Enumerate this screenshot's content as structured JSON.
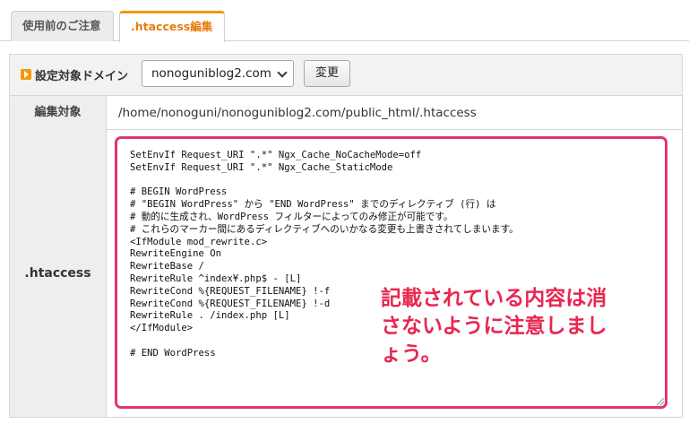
{
  "tabs": [
    {
      "label": "使用前のご注意",
      "active": false
    },
    {
      "label": ".htaccess編集",
      "active": true
    }
  ],
  "domain_row": {
    "icon": "orange-arrow-icon",
    "label": "設定対象ドメイン",
    "selected_domain": "nonoguniblog2.com",
    "change_button": "変更"
  },
  "target_row": {
    "label": "編集対象",
    "path": "/home/nonoguni/nonoguniblog2.com/public_html/.htaccess"
  },
  "htaccess_row": {
    "label": ".htaccess",
    "content": "SetEnvIf Request_URI \".*\" Ngx_Cache_NoCacheMode=off\nSetEnvIf Request_URI \".*\" Ngx_Cache_StaticMode\n\n# BEGIN WordPress\n# \"BEGIN WordPress\" から \"END WordPress\" までのディレクティブ (行) は\n# 動的に生成され、WordPress フィルターによってのみ修正が可能です。\n# これらのマーカー間にあるディレクティブへのいかなる変更も上書きされてしまいます。\n<IfModule mod_rewrite.c>\nRewriteEngine On\nRewriteBase /\nRewriteRule ^index¥.php$ - [L]\nRewriteCond %{REQUEST_FILENAME} !-f\nRewriteCond %{REQUEST_FILENAME} !-d\nRewriteRule . /index.php [L]\n</IfModule>\n\n# END WordPress"
  },
  "annotation": {
    "text": "記載されている内容は消さないように注意しましょう。",
    "color": "#e8264f",
    "border_color": "#e0366a"
  }
}
